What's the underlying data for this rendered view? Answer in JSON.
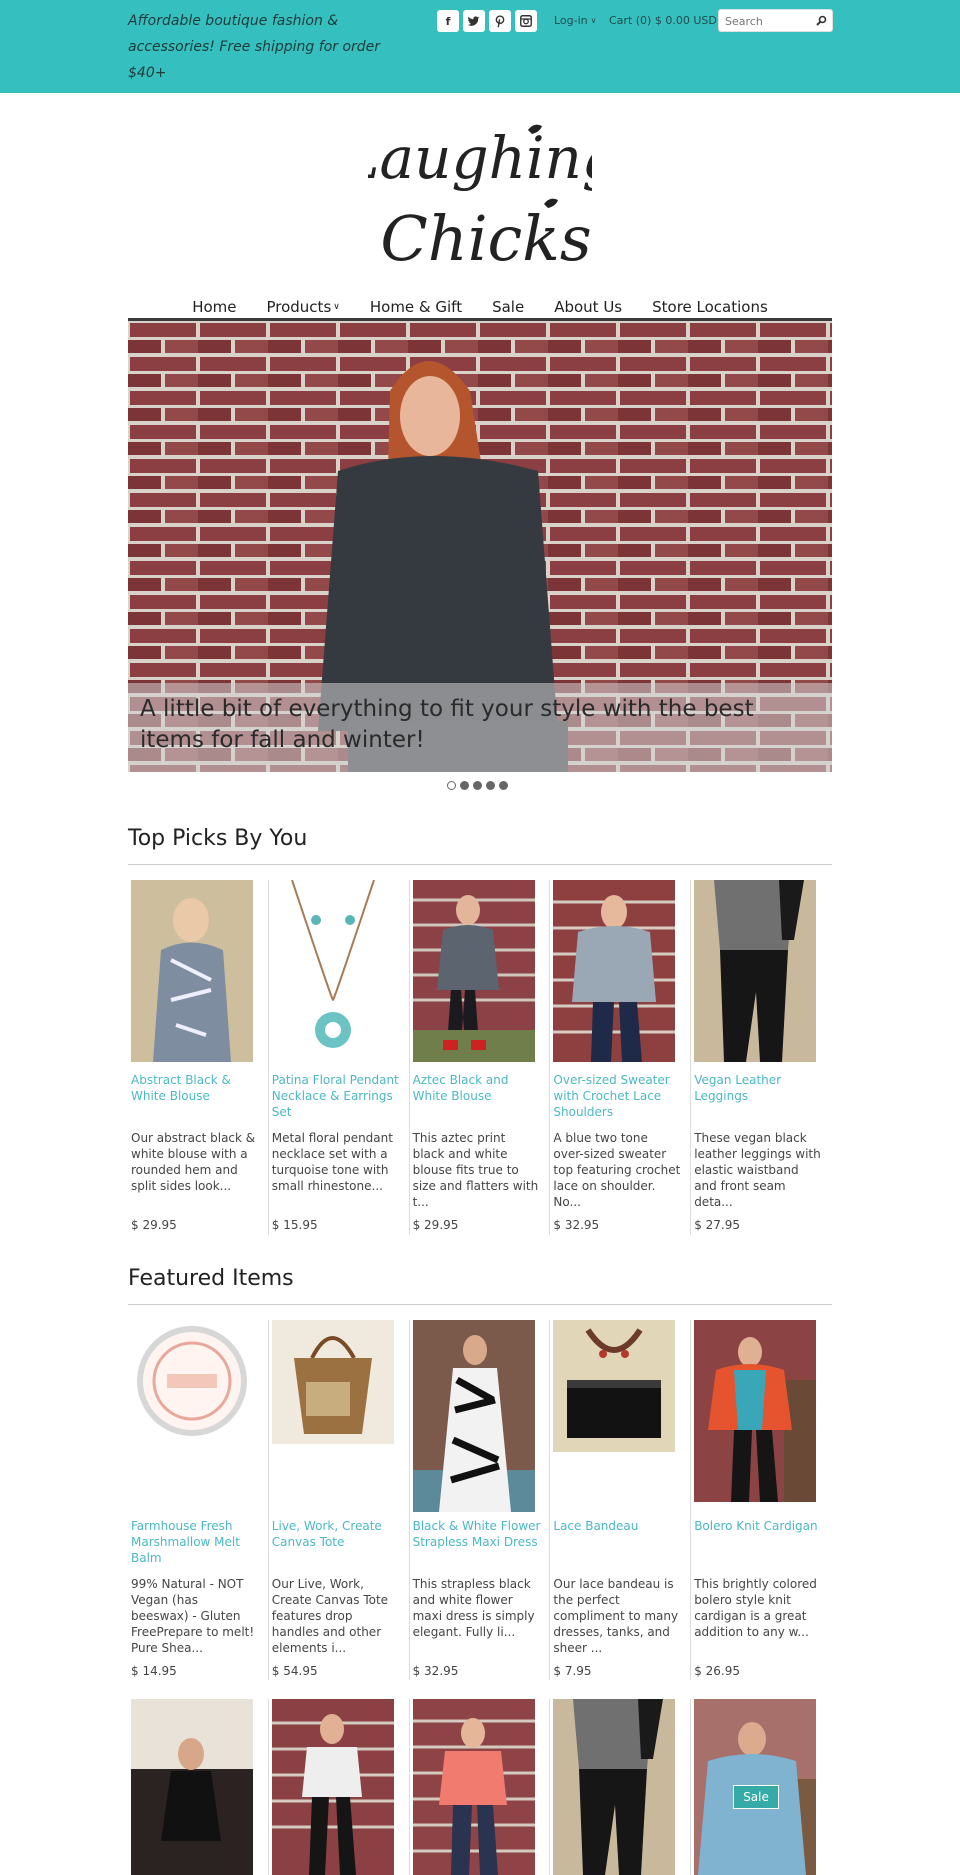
{
  "header": {
    "tagline": "Affordable boutique fashion & accessories! Free shipping for order $40+",
    "social": [
      {
        "name": "facebook-icon",
        "glyph": "f"
      },
      {
        "name": "twitter-icon",
        "glyph": ""
      },
      {
        "name": "pinterest-icon",
        "glyph": ""
      },
      {
        "name": "instagram-icon",
        "glyph": ""
      }
    ],
    "login_label": "Log-in",
    "cart_label": "Cart (0) $ 0.00 USD",
    "search_placeholder": "Search",
    "brand_color": "#35bfbf"
  },
  "logo": {
    "line1": "Laughing",
    "line2": "Chicks"
  },
  "nav": {
    "items": [
      "Home",
      "Products",
      "Home & Gift",
      "Sale",
      "About Us",
      "Store Locations"
    ]
  },
  "hero": {
    "caption": "A little bit of everything to fit your style with the best items for fall and winter!",
    "slides": 5,
    "active_slide": 1
  },
  "top_picks": {
    "title": "Top Picks By You",
    "products": [
      {
        "name": "Abstract Black & White Blouse",
        "desc": "Our abstract black & white blouse with a rounded hem and split sides look...",
        "price": "$ 29.95"
      },
      {
        "name": "Patina Floral Pendant Necklace & Earrings Set",
        "desc": "Metal floral pendant necklace set with a turquoise tone with small rhinestone...",
        "price": "$ 15.95"
      },
      {
        "name": "Aztec Black and White Blouse",
        "desc": "This aztec print black and white blouse fits true to size and flatters with t...",
        "price": "$ 29.95"
      },
      {
        "name": "Over-sized Sweater with Crochet Lace Shoulders",
        "desc": "A blue two tone over-sized sweater top featuring crochet lace on shoulder. No...",
        "price": "$ 32.95"
      },
      {
        "name": "Vegan Leather Leggings",
        "desc": "These vegan black leather leggings with elastic waistband and front seam deta...",
        "price": "$ 27.95"
      }
    ]
  },
  "featured": {
    "title": "Featured Items",
    "products": [
      {
        "name": "Farmhouse Fresh Marshmallow Melt Balm",
        "desc": "99% Natural - NOT Vegan (has beeswax) - Gluten FreePrepare to melt! Pure Shea...",
        "price": "$ 14.95"
      },
      {
        "name": "Live, Work, Create Canvas Tote",
        "desc": "Our Live, Work, Create Canvas Tote features drop handles and other elements i...",
        "price": "$ 54.95"
      },
      {
        "name": "Black & White Flower Strapless Maxi Dress",
        "desc": "This strapless black and white flower maxi dress is simply elegant.  Fully li...",
        "price": "$ 32.95"
      },
      {
        "name": "Lace Bandeau",
        "desc": "Our lace bandeau is the perfect compliment to many dresses, tanks, and sheer ...",
        "price": "$ 7.95"
      },
      {
        "name": "Bolero Knit Cardigan",
        "desc": "This brightly colored bolero style knit cardigan is a great addition to any w...",
        "price": "$ 26.95"
      }
    ],
    "sale_label": "Sale"
  }
}
